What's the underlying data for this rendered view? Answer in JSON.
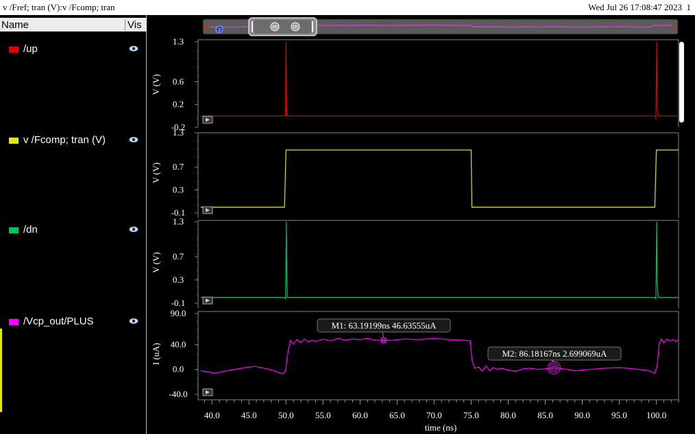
{
  "window": {
    "title": "v /Fref; tran (V):v /Fcomp; tran",
    "timestamp": "Wed Jul 26 17:08:47 2023",
    "page_number": "1"
  },
  "sidebar": {
    "columns": {
      "name": "Name",
      "vis": "Vis"
    },
    "signals": [
      {
        "label": "/up",
        "color": "#e00000",
        "icon": "eye-icon"
      },
      {
        "label": "v /Fcomp; tran (V)",
        "color": "#e6e600",
        "icon": "eye-icon"
      },
      {
        "label": "/dn",
        "color": "#00c060",
        "icon": "eye-icon"
      },
      {
        "label": "/Vcp_out/PLUS",
        "color": "#ff00ff",
        "icon": "eye-icon"
      }
    ]
  },
  "overview": {
    "marker_labels": [
      "m",
      "m"
    ],
    "badge": "3"
  },
  "chart_data": {
    "type": "line",
    "xlabel": "time (ns)",
    "xlim": [
      38.5,
      103.0
    ],
    "xticks": [
      40.0,
      45.0,
      50.0,
      55.0,
      60.0,
      65.0,
      70.0,
      75.0,
      80.0,
      85.0,
      90.0,
      95.0,
      100.0
    ],
    "panels": [
      {
        "name": "/up",
        "color": "#e00000",
        "ylabel": "V (V)",
        "ylim": [
          -0.2,
          1.3
        ],
        "yticks": [
          1.3,
          0.6,
          0.2,
          -0.2
        ],
        "series": [
          {
            "name": "/up",
            "x": [
              38.5,
              49.92,
              50.0,
              50.08,
              50.12,
              50.2,
              99.88,
              99.95,
              100.05,
              100.12,
              100.25,
              103.0
            ],
            "y": [
              0.0,
              0.0,
              1.3,
              0.15,
              0.0,
              0.0,
              0.0,
              -0.05,
              1.3,
              0.15,
              0.0,
              0.0
            ]
          }
        ]
      },
      {
        "name": "v /Fcomp; tran (V)",
        "color": "#e6e600",
        "ylabel": "V (V)",
        "ylim": [
          -0.1,
          1.3
        ],
        "yticks": [
          1.3,
          0.7,
          0.3,
          -0.1
        ],
        "series": [
          {
            "name": "v /Fcomp; tran (V)",
            "x": [
              38.5,
              49.8,
              49.9,
              50.0,
              75.0,
              75.1,
              99.8,
              99.9,
              100.0,
              103.0
            ],
            "y": [
              0.0,
              0.0,
              0.5,
              1.0,
              1.0,
              0.0,
              0.0,
              0.5,
              1.0,
              1.0
            ]
          }
        ]
      },
      {
        "name": "/dn",
        "color": "#00c060",
        "ylabel": "V (V)",
        "ylim": [
          -0.1,
          1.3
        ],
        "yticks": [
          1.3,
          0.7,
          0.3,
          -0.1
        ],
        "series": [
          {
            "name": "/dn",
            "x": [
              38.5,
              49.88,
              49.95,
              50.05,
              50.12,
              50.2,
              99.85,
              99.95,
              100.05,
              100.12,
              100.25,
              103.0
            ],
            "y": [
              0.0,
              0.0,
              -0.03,
              1.3,
              0.25,
              0.0,
              0.0,
              -0.03,
              1.3,
              0.25,
              0.0,
              0.0
            ]
          }
        ]
      },
      {
        "name": "/Vcp_out/PLUS",
        "color": "#ff00ff",
        "ylabel": "I (uA)",
        "ylim": [
          -40.0,
          90.0
        ],
        "yticks": [
          90.0,
          40.0,
          0.0,
          -40.0
        ],
        "series": [
          {
            "name": "/Vcp_out/PLUS",
            "x": [
              38.5,
              40.5,
              42.5,
              44.5,
              45.8,
              47.5,
              49.6,
              49.9,
              50.3,
              50.6,
              51.0,
              51.5,
              52.0,
              52.5,
              53.0,
              53.5,
              54.0,
              55.0,
              56.0,
              57.0,
              58.0,
              59.0,
              60.0,
              61.0,
              62.0,
              63.2,
              64.5,
              66.0,
              68.0,
              70.0,
              72.0,
              74.0,
              74.9,
              75.1,
              75.5,
              76.0,
              76.5,
              77.0,
              77.5,
              78.0,
              78.5,
              79.0,
              80.0,
              81.0,
              82.0,
              83.0,
              84.0,
              85.0,
              86.2,
              87.5,
              89.0,
              91.0,
              93.0,
              95.0,
              97.0,
              99.0,
              99.8,
              100.1,
              100.4,
              100.7,
              101.0,
              101.4,
              101.8,
              102.2,
              102.6,
              103.0
            ],
            "y": [
              -2,
              -6,
              -1,
              3,
              5,
              1,
              -7,
              -3,
              30,
              47,
              41,
              48,
              43,
              49,
              44,
              47,
              45,
              49,
              46,
              50,
              47,
              49,
              48,
              50,
              47,
              46.6,
              47,
              49,
              48,
              50,
              48,
              47,
              46,
              15,
              2,
              4,
              -3,
              6,
              -2,
              3,
              0,
              2,
              -1,
              -3,
              1,
              2,
              0,
              1,
              2.7,
              1,
              -2,
              0,
              2,
              3,
              1,
              -2,
              -6,
              5,
              42,
              49,
              43,
              49,
              46,
              48,
              45,
              48
            ]
          }
        ],
        "markers": [
          {
            "label": "M1: 63.19199ns 46.63555uA",
            "x": 63.19199,
            "y": 46.63555
          },
          {
            "label": "M2: 86.18167ns 2.699069uA",
            "x": 86.18167,
            "y": 2.699069
          }
        ]
      }
    ],
    "grid": false
  }
}
